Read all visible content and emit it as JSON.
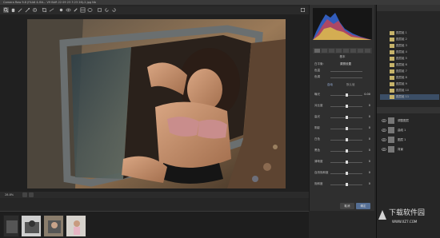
{
  "window": {
    "title": "Camera Raw 9.8 (F4A6 & Bit… V9 BAR 22 09 23 3 23 26)-2.jpg Nb",
    "zoom": "28.8%"
  },
  "toolbar": {
    "tools": [
      "zoom-icon",
      "hand-icon",
      "white-balance-icon",
      "color-sampler-icon",
      "targeted-adjust-icon",
      "crop-icon",
      "straighten-icon",
      "spot-removal-icon",
      "red-eye-icon",
      "adjustment-brush-icon",
      "graduated-filter-icon",
      "radial-filter-icon",
      "preferences-icon",
      "rotate-ccw-icon",
      "rotate-cw-icon"
    ]
  },
  "right_panel": {
    "section_basic": "基本",
    "white_balance_label": "白平衡:",
    "white_balance_value": "原照设置",
    "temperature_label": "色温",
    "tint_label": "色调",
    "auto_label": "自动",
    "default_label": "默认值",
    "sliders": [
      {
        "label": "曝光",
        "value": "0.00",
        "fraction": 0.5
      },
      {
        "label": "对比度",
        "value": "0",
        "fraction": 0.5
      },
      {
        "label": "高光",
        "value": "0",
        "fraction": 0.5
      },
      {
        "label": "阴影",
        "value": "0",
        "fraction": 0.5
      },
      {
        "label": "白色",
        "value": "0",
        "fraction": 0.5
      },
      {
        "label": "黑色",
        "value": "0",
        "fraction": 0.5
      },
      {
        "label": "清晰度",
        "value": "0",
        "fraction": 0.5
      },
      {
        "label": "自然饱和度",
        "value": "0",
        "fraction": 0.5
      },
      {
        "label": "饱和度",
        "value": "0",
        "fraction": 0.5
      }
    ],
    "buttons": {
      "cancel": "取消",
      "ok": "确定"
    }
  },
  "ps_panel": {
    "folders": [
      "图层组 1",
      "图层组 2",
      "图层组 3",
      "图层组 4",
      "图层组 5",
      "图层组 6",
      "图层组 7",
      "图层组 8",
      "图层组 9",
      "图层组 10",
      "图层组 11"
    ],
    "layers": [
      "调整图层",
      "曲线 1",
      "图层 1",
      "背景"
    ]
  },
  "watermark": {
    "text": "下载软件园",
    "url": "WWW.XZ7.COM"
  },
  "colors": {
    "accent": "#3b4e66",
    "histogram_red": "#e04040",
    "histogram_blue": "#3a6fe6",
    "histogram_yellow": "#e6d84a"
  }
}
